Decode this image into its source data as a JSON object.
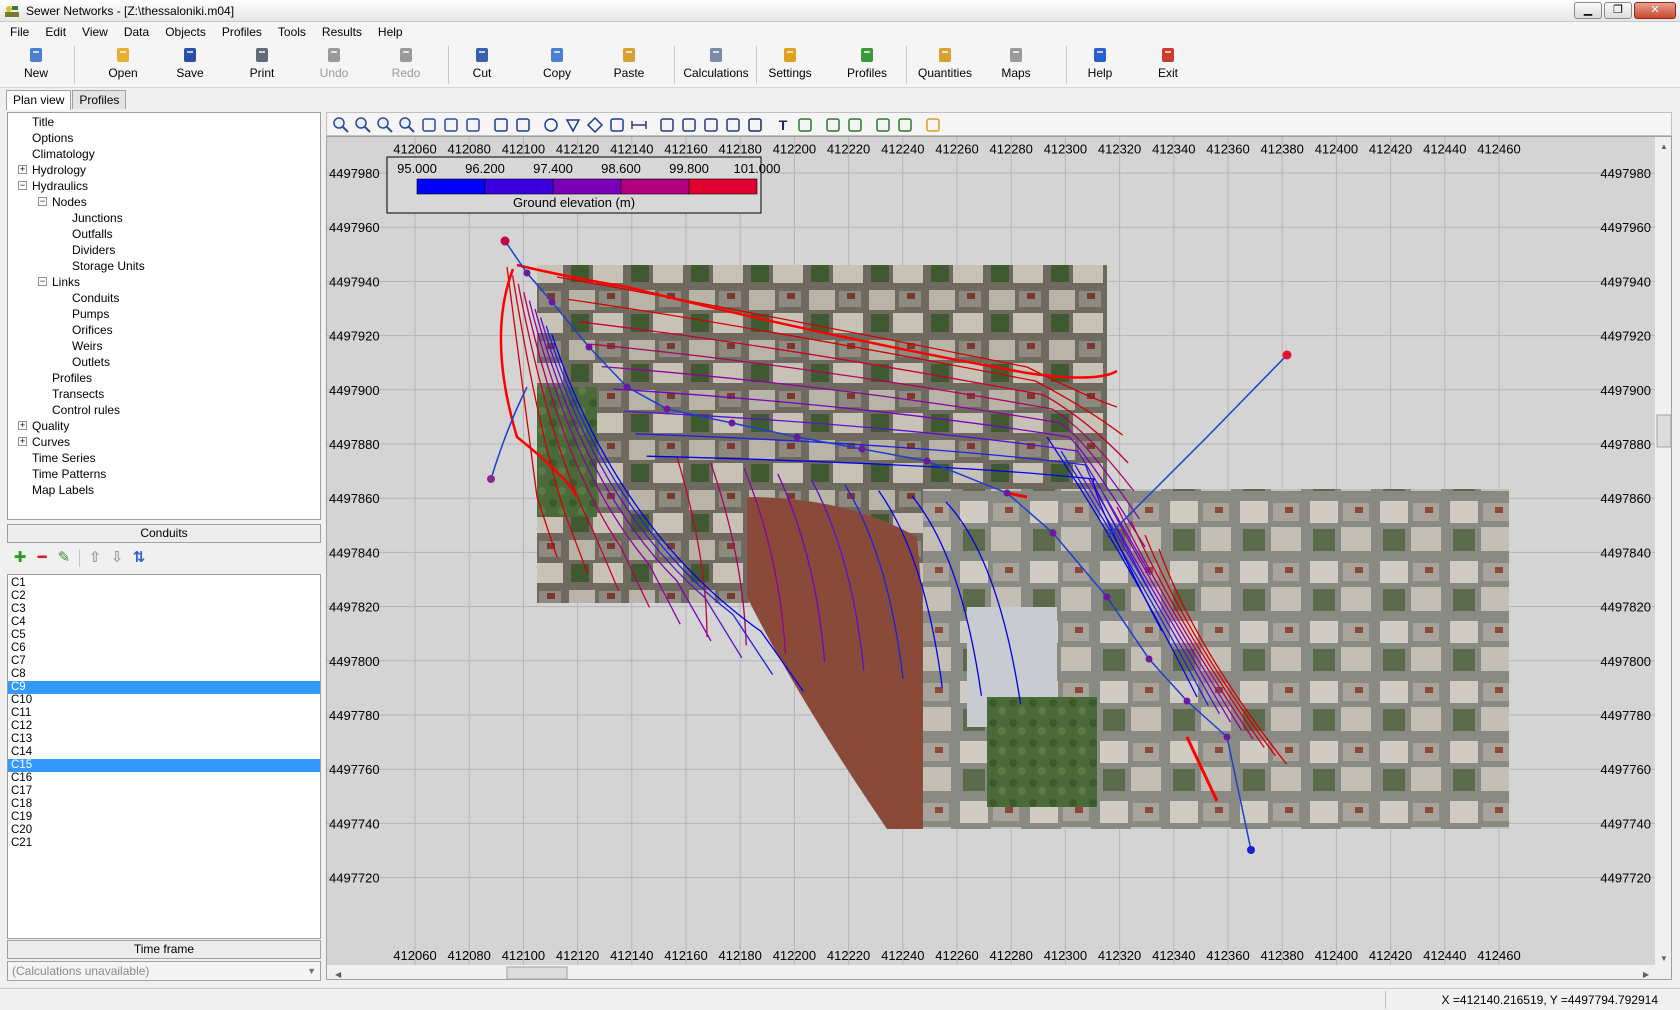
{
  "window": {
    "title": "Sewer Networks - [Z:\\thessaloniki.m04]",
    "minimize": "▁",
    "restore": "❐",
    "close": "✕"
  },
  "menu": [
    "File",
    "Edit",
    "View",
    "Data",
    "Objects",
    "Profiles",
    "Tools",
    "Results",
    "Help"
  ],
  "toolbar": [
    {
      "label": "New",
      "icon": "new-document-icon",
      "color": "#4a7fd4",
      "enabled": true
    },
    {
      "label": "Open",
      "icon": "open-folder-icon",
      "color": "#e8b030",
      "enabled": true
    },
    {
      "label": "Save",
      "icon": "floppy-disk-icon",
      "color": "#2b4fa8",
      "enabled": true
    },
    {
      "label": "Print",
      "icon": "printer-icon",
      "color": "#606a78",
      "enabled": true
    },
    {
      "label": "Undo",
      "icon": "undo-arrow-icon",
      "color": "#9a9a9a",
      "enabled": false
    },
    {
      "label": "Redo",
      "icon": "redo-arrow-icon",
      "color": "#9a9a9a",
      "enabled": false
    },
    {
      "label": "Cut",
      "icon": "scissors-icon",
      "color": "#3a5fb0",
      "enabled": true
    },
    {
      "label": "Copy",
      "icon": "copy-pages-icon",
      "color": "#4a7fd4",
      "enabled": true
    },
    {
      "label": "Paste",
      "icon": "clipboard-icon",
      "color": "#d8a030",
      "enabled": true
    },
    {
      "label": "Calculations",
      "icon": "calculator-icon",
      "color": "#7a8aa8",
      "enabled": true
    },
    {
      "label": "Settings",
      "icon": "wrench-icon",
      "color": "#e0a020",
      "enabled": true
    },
    {
      "label": "Profiles",
      "icon": "profile-edit-icon",
      "color": "#3a9a3a",
      "enabled": true
    },
    {
      "label": "Quantities",
      "icon": "quantities-list-icon",
      "color": "#d8a030",
      "enabled": true
    },
    {
      "label": "Maps",
      "icon": "map-pin-icon",
      "color": "#9a9a9a",
      "enabled": true
    },
    {
      "label": "Help",
      "icon": "help-question-icon",
      "color": "#2b5fd0",
      "enabled": true
    },
    {
      "label": "Exit",
      "icon": "exit-door-icon",
      "color": "#d03a2a",
      "enabled": true
    }
  ],
  "tabs": [
    "Plan view",
    "Profiles"
  ],
  "tree": [
    {
      "label": "Title",
      "level": 0,
      "expander": ""
    },
    {
      "label": "Options",
      "level": 0,
      "expander": ""
    },
    {
      "label": "Climatology",
      "level": 0,
      "expander": ""
    },
    {
      "label": "Hydrology",
      "level": 0,
      "expander": "+"
    },
    {
      "label": "Hydraulics",
      "level": 0,
      "expander": "−"
    },
    {
      "label": "Nodes",
      "level": 1,
      "expander": "−"
    },
    {
      "label": "Junctions",
      "level": 2,
      "expander": ""
    },
    {
      "label": "Outfalls",
      "level": 2,
      "expander": ""
    },
    {
      "label": "Dividers",
      "level": 2,
      "expander": ""
    },
    {
      "label": "Storage Units",
      "level": 2,
      "expander": ""
    },
    {
      "label": "Links",
      "level": 1,
      "expander": "−"
    },
    {
      "label": "Conduits",
      "level": 2,
      "expander": ""
    },
    {
      "label": "Pumps",
      "level": 2,
      "expander": ""
    },
    {
      "label": "Orifices",
      "level": 2,
      "expander": ""
    },
    {
      "label": "Weirs",
      "level": 2,
      "expander": ""
    },
    {
      "label": "Outlets",
      "level": 2,
      "expander": ""
    },
    {
      "label": "Profiles",
      "level": 1,
      "expander": ""
    },
    {
      "label": "Transects",
      "level": 1,
      "expander": ""
    },
    {
      "label": "Control rules",
      "level": 1,
      "expander": ""
    },
    {
      "label": "Quality",
      "level": 0,
      "expander": "+"
    },
    {
      "label": "Curves",
      "level": 0,
      "expander": "+"
    },
    {
      "label": "Time Series",
      "level": 0,
      "expander": ""
    },
    {
      "label": "Time Patterns",
      "level": 0,
      "expander": ""
    },
    {
      "label": "Map Labels",
      "level": 0,
      "expander": ""
    }
  ],
  "conduits_header": "Conduits",
  "list_buttons": [
    {
      "glyph": "✚",
      "icon": "add-icon",
      "color": "#2a9a2a"
    },
    {
      "glyph": "━",
      "icon": "remove-icon",
      "color": "#d02020"
    },
    {
      "glyph": "✎",
      "icon": "edit-icon",
      "color": "#3a8a3a"
    },
    {
      "glyph": "⇧",
      "icon": "move-up-icon",
      "color": "#9a9a9a"
    },
    {
      "glyph": "⇩",
      "icon": "move-down-icon",
      "color": "#9a9a9a"
    },
    {
      "glyph": "⇅",
      "icon": "sort-icon",
      "color": "#2b5fd0"
    }
  ],
  "conduits": [
    "C1",
    "C2",
    "C3",
    "C4",
    "C5",
    "C6",
    "C7",
    "C8",
    "C9",
    "C10",
    "C11",
    "C12",
    "C13",
    "C14",
    "C15",
    "C16",
    "C17",
    "C18",
    "C19",
    "C20",
    "C21"
  ],
  "selected_conduits": [
    "C9",
    "C15"
  ],
  "time_frame_header": "Time frame",
  "time_frame_value": "(Calculations unavailable)",
  "map": {
    "x_ticks": [
      "412060",
      "412080",
      "412100",
      "412120",
      "412140",
      "412160",
      "412180",
      "412200",
      "412220",
      "412240",
      "412260",
      "412280",
      "412300",
      "412320",
      "412340",
      "412360",
      "412380",
      "412400",
      "412420",
      "412440",
      "412460"
    ],
    "y_ticks": [
      "4497980",
      "4497960",
      "4497940",
      "4497920",
      "4497900",
      "4497880",
      "4497860",
      "4497840",
      "4497820",
      "4497800",
      "4497780",
      "4497760",
      "4497740",
      "4497720"
    ],
    "legend": {
      "title": "Ground elevation (m)",
      "values": [
        "95.000",
        "96.200",
        "97.400",
        "98.600",
        "99.800",
        "101.000"
      ],
      "colors": [
        "#0000ff",
        "#3a00e0",
        "#7a00b8",
        "#b00080",
        "#e00030"
      ]
    }
  },
  "status": {
    "coords": "X =412140.216519, Y =4497794.792914"
  }
}
